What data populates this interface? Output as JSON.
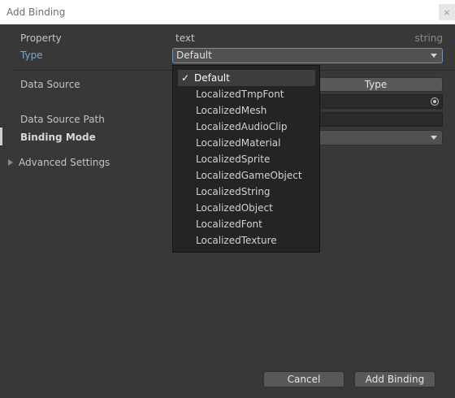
{
  "window": {
    "title": "Add Binding",
    "close_icon": "×"
  },
  "property": {
    "label": "Property",
    "value": "text",
    "type": "string"
  },
  "type": {
    "label": "Type",
    "selected": "Default"
  },
  "data_source": {
    "label": "Data Source",
    "type_button": "Type"
  },
  "data_source_path": {
    "label": "Data Source Path"
  },
  "binding_mode": {
    "label": "Binding Mode"
  },
  "advanced": {
    "label": "Advanced Settings"
  },
  "popup": {
    "items": [
      {
        "label": "Default",
        "check": "✓"
      },
      {
        "label": "LocalizedTmpFont"
      },
      {
        "label": "LocalizedMesh"
      },
      {
        "label": "LocalizedAudioClip"
      },
      {
        "label": "LocalizedMaterial"
      },
      {
        "label": "LocalizedSprite"
      },
      {
        "label": "LocalizedGameObject"
      },
      {
        "label": "LocalizedString"
      },
      {
        "label": "LocalizedObject"
      },
      {
        "label": "LocalizedFont"
      },
      {
        "label": "LocalizedTexture"
      }
    ]
  },
  "footer": {
    "cancel_label": "Cancel",
    "add_label": "Add Binding"
  },
  "colors": {
    "background": "#383838",
    "accent": "#6b93c8",
    "popup_bg": "#242424"
  }
}
